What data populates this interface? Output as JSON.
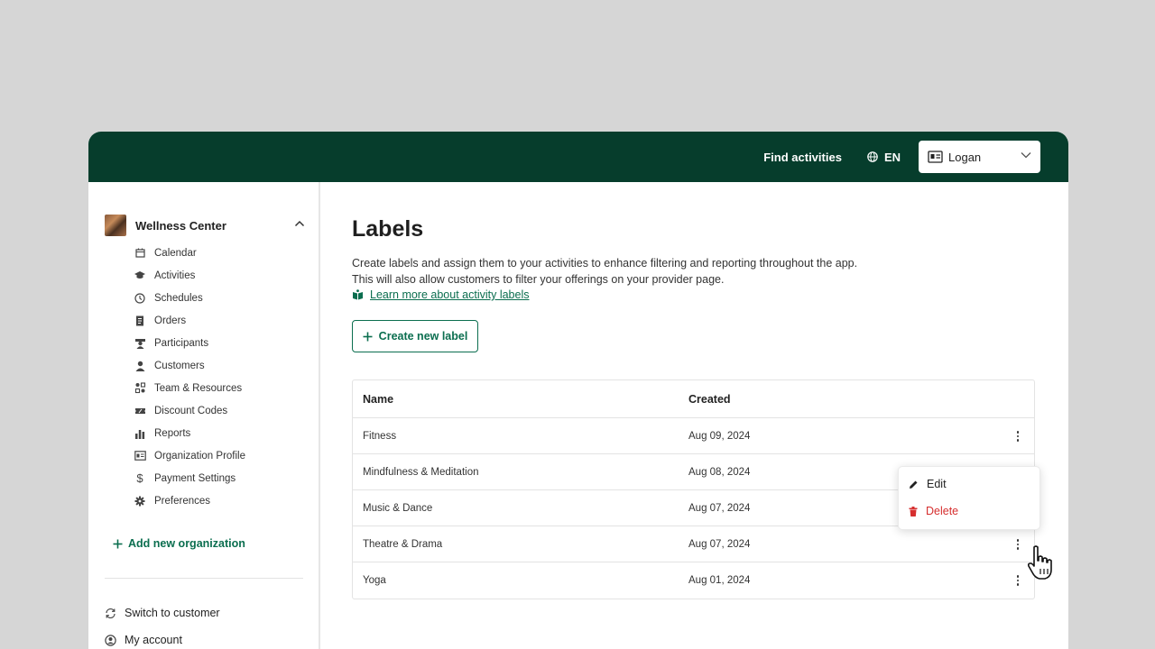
{
  "topbar": {
    "find_label": "Find activities",
    "lang_label": "EN",
    "user_name": "Logan"
  },
  "sidebar": {
    "org_name": "Wellness Center",
    "items": [
      {
        "label": "Calendar",
        "icon": "calendar-icon"
      },
      {
        "label": "Activities",
        "icon": "graduation-cap-icon"
      },
      {
        "label": "Schedules",
        "icon": "clock-icon"
      },
      {
        "label": "Orders",
        "icon": "receipt-icon"
      },
      {
        "label": "Participants",
        "icon": "participant-icon"
      },
      {
        "label": "Customers",
        "icon": "person-icon"
      },
      {
        "label": "Team & Resources",
        "icon": "team-icon"
      },
      {
        "label": "Discount Codes",
        "icon": "discount-icon"
      },
      {
        "label": "Reports",
        "icon": "bar-chart-icon"
      },
      {
        "label": "Organization Profile",
        "icon": "id-card-icon"
      },
      {
        "label": "Payment Settings",
        "icon": "dollar-icon"
      },
      {
        "label": "Preferences",
        "icon": "gear-icon"
      }
    ],
    "add_org_label": "Add new organization",
    "switch_label": "Switch to customer",
    "account_label": "My account"
  },
  "main": {
    "title": "Labels",
    "desc_line1": "Create labels and assign them to your activities to enhance filtering and reporting throughout the app.",
    "desc_line2": "This will also allow customers to filter your offerings on your provider page.",
    "learn_link": "Learn more about activity labels",
    "create_button": "Create new label"
  },
  "table": {
    "headers": {
      "name": "Name",
      "created": "Created"
    },
    "rows": [
      {
        "name": "Fitness",
        "created": "Aug 09, 2024"
      },
      {
        "name": "Mindfulness & Meditation",
        "created": "Aug 08, 2024"
      },
      {
        "name": "Music & Dance",
        "created": "Aug 07, 2024"
      },
      {
        "name": "Theatre & Drama",
        "created": "Aug 07, 2024"
      },
      {
        "name": "Yoga",
        "created": "Aug 01, 2024"
      }
    ]
  },
  "context_menu": {
    "edit_label": "Edit",
    "delete_label": "Delete"
  },
  "colors": {
    "brand_dark": "#063d2c",
    "accent_green": "#0b6e4f",
    "danger_red": "#d62f2f"
  }
}
